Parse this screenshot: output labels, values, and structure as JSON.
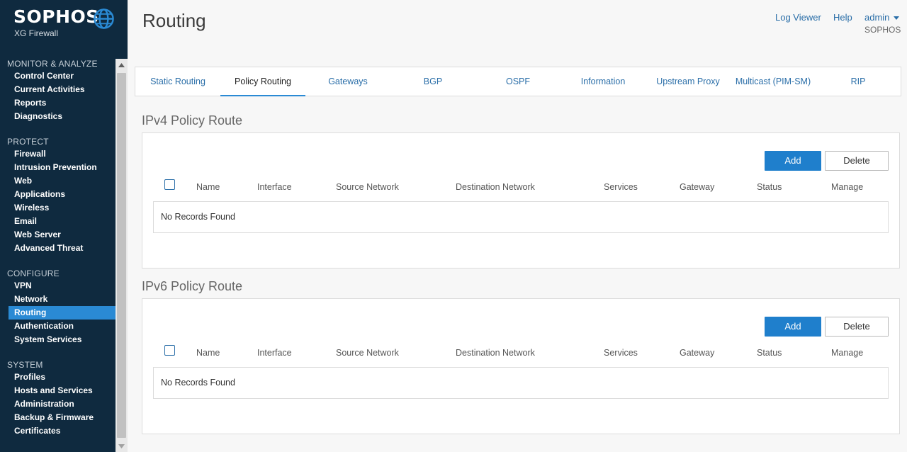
{
  "brand": {
    "name": "SOPHOS",
    "product": "XG Firewall"
  },
  "nav": {
    "sections": [
      {
        "title": "MONITOR & ANALYZE",
        "items": [
          "Control Center",
          "Current Activities",
          "Reports",
          "Diagnostics"
        ]
      },
      {
        "title": "PROTECT",
        "items": [
          "Firewall",
          "Intrusion Prevention",
          "Web",
          "Applications",
          "Wireless",
          "Email",
          "Web Server",
          "Advanced Threat"
        ]
      },
      {
        "title": "CONFIGURE",
        "items": [
          "VPN",
          "Network",
          "Routing",
          "Authentication",
          "System Services"
        ]
      },
      {
        "title": "SYSTEM",
        "items": [
          "Profiles",
          "Hosts and Services",
          "Administration",
          "Backup & Firmware",
          "Certificates"
        ]
      }
    ],
    "active": "Routing"
  },
  "header": {
    "title": "Routing",
    "log_viewer": "Log Viewer",
    "help": "Help",
    "user": "admin",
    "org": "SOPHOS"
  },
  "tabs": [
    {
      "label": "Static Routing",
      "active": false
    },
    {
      "label": "Policy Routing",
      "active": true
    },
    {
      "label": "Gateways",
      "active": false
    },
    {
      "label": "BGP",
      "active": false
    },
    {
      "label": "OSPF",
      "active": false
    },
    {
      "label": "Information",
      "active": false
    },
    {
      "label": "Upstream Proxy",
      "active": false
    },
    {
      "label": "Multicast (PIM-SM)",
      "active": false
    },
    {
      "label": "RIP",
      "active": false
    }
  ],
  "ipv4": {
    "title": "IPv4 Policy Route",
    "add": "Add",
    "delete": "Delete",
    "columns": [
      "Name",
      "Interface",
      "Source Network",
      "Destination Network",
      "Services",
      "Gateway",
      "Status",
      "Manage"
    ],
    "empty": "No Records Found"
  },
  "ipv6": {
    "title": "IPv6 Policy Route",
    "add": "Add",
    "delete": "Delete",
    "columns": [
      "Name",
      "Interface",
      "Source Network",
      "Destination Network",
      "Services",
      "Gateway",
      "Status",
      "Manage"
    ],
    "empty": "No Records Found"
  },
  "colors": {
    "sidebar": "#0f2a3f",
    "accent": "#2a8ad4",
    "link": "#2a6ea8",
    "button": "#1f7fcc"
  }
}
